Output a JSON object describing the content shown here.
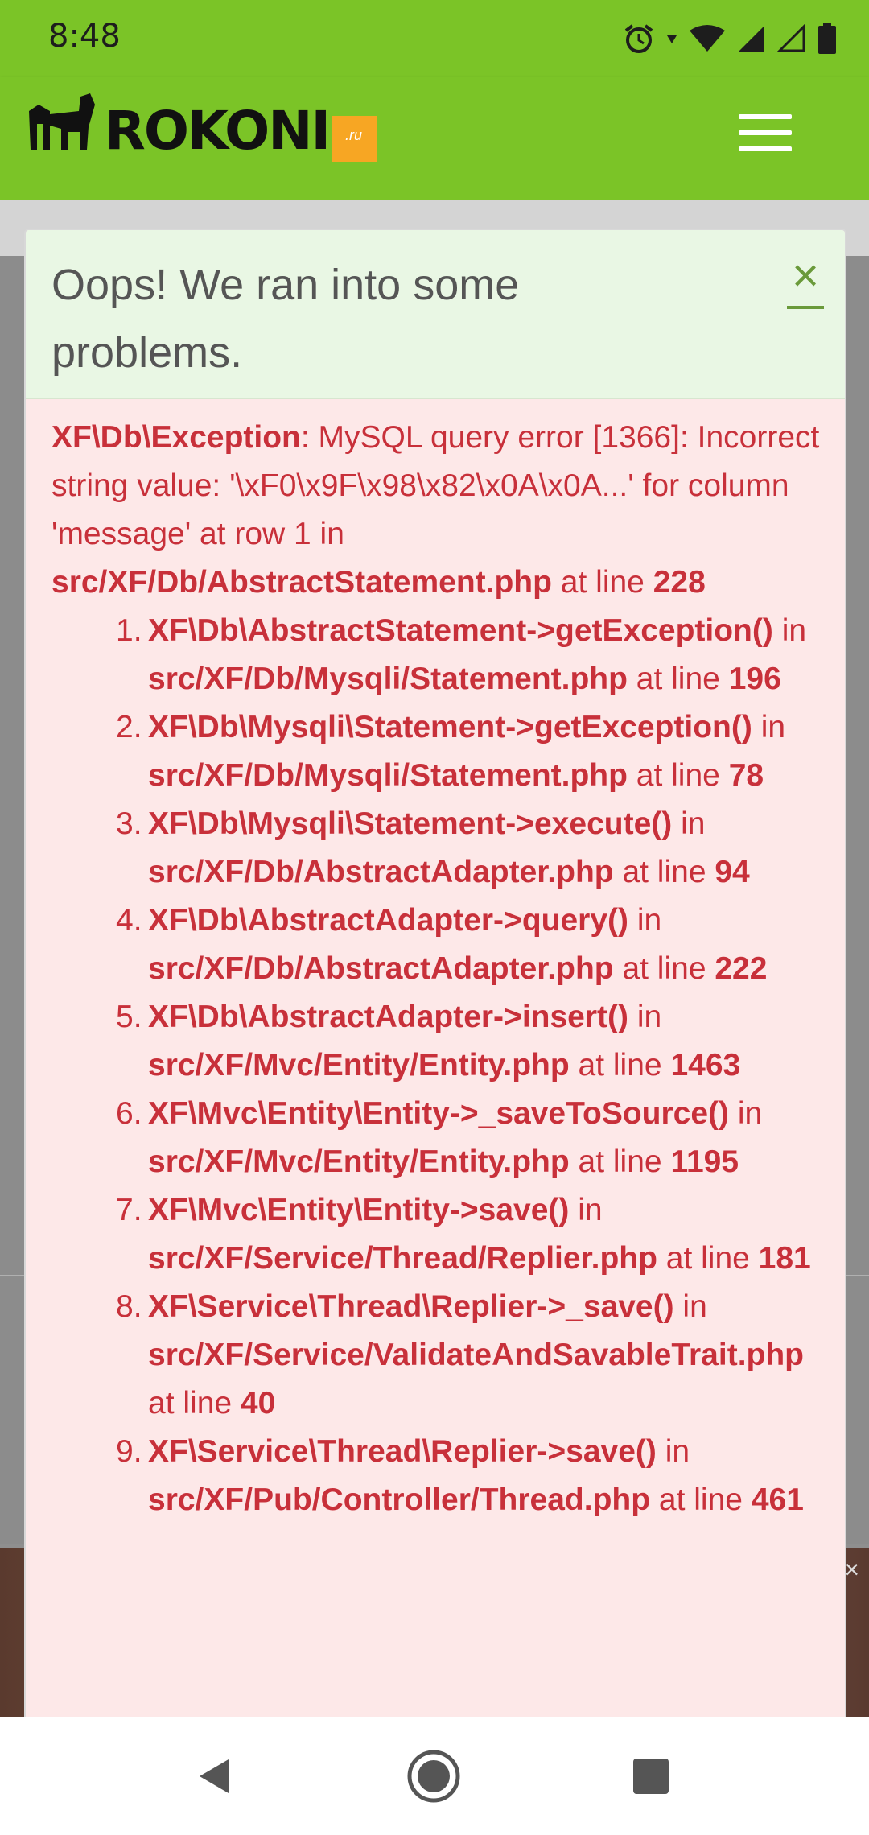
{
  "status_bar": {
    "time": "8:48"
  },
  "header": {
    "logo_text": "ROKONI",
    "logo_tld": ".ru"
  },
  "error": {
    "title": "Oops! We ran into some problems.",
    "close_glyph": "×",
    "exception": {
      "type": "XF\\Db\\Exception",
      "message": ": MySQL query error [1366]: Incorrect string value: '\\xF0\\x9F\\x98\\x82\\x0A\\x0A...' for column 'message' at row 1 in ",
      "file": "src/XF/Db/AbstractStatement.php",
      "at_line": " at line ",
      "line": "228"
    },
    "trace": [
      {
        "num": "1.",
        "func": "XF\\Db\\AbstractStatement->getException()",
        "in": " in ",
        "file": "src/XF/Db/Mysqli/Statement.php",
        "at": " at line ",
        "line": "196"
      },
      {
        "num": "2.",
        "func": "XF\\Db\\Mysqli\\Statement->getException()",
        "in": " in ",
        "file": "src/XF/Db/Mysqli/Statement.php",
        "at": " at line ",
        "line": "78"
      },
      {
        "num": "3.",
        "func": "XF\\Db\\Mysqli\\Statement->execute()",
        "in": " in ",
        "file": "src/XF/Db/AbstractAdapter.php",
        "at": " at line ",
        "line": "94"
      },
      {
        "num": "4.",
        "func": "XF\\Db\\AbstractAdapter->query()",
        "in": " in ",
        "file": "src/XF/Db/AbstractAdapter.php",
        "at": " at line ",
        "line": "222"
      },
      {
        "num": "5.",
        "func": "XF\\Db\\AbstractAdapter->insert()",
        "in": " in ",
        "file": "src/XF/Mvc/Entity/Entity.php",
        "at": " at line ",
        "line": "1463"
      },
      {
        "num": "6.",
        "func": "XF\\Mvc\\Entity\\Entity->_saveToSource()",
        "in": " in ",
        "file": "src/XF/Mvc/Entity/Entity.php",
        "at": " at line ",
        "line": "1195"
      },
      {
        "num": "7.",
        "func": "XF\\Mvc\\Entity\\Entity->save()",
        "in": " in ",
        "file": "src/XF/Service/Thread/Replier.php",
        "at": " at line ",
        "line": "181"
      },
      {
        "num": "8.",
        "func": "XF\\Service\\Thread\\Replier->_save()",
        "in": " in ",
        "file": "src/XF/Service/ValidateAndSavableTrait.php",
        "at": " at line ",
        "line": "40"
      },
      {
        "num": "9.",
        "func": "XF\\Service\\Thread\\Replier->save()",
        "in": " in ",
        "file": "src/XF/Pub/Controller/Thread.php",
        "at": " at line ",
        "line": "461"
      }
    ]
  },
  "ad": {
    "close_glyph": "×"
  },
  "colors": {
    "header_green": "#7bc427",
    "error_red": "#c8303a",
    "panel_pink": "#fde8e8",
    "title_bg": "#e9f7e4"
  }
}
